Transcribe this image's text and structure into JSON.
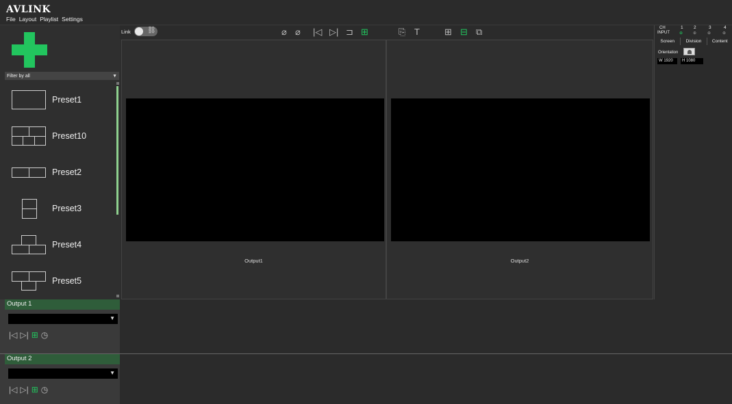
{
  "app": {
    "logo": "AVLINK"
  },
  "menu": [
    {
      "label": "File"
    },
    {
      "label": "Layout"
    },
    {
      "label": "Playlist"
    },
    {
      "label": "Settings"
    }
  ],
  "left_panel": {
    "filter_label": "Filter by all",
    "presets": [
      {
        "label": "Preset1",
        "thumb": "single"
      },
      {
        "label": "Preset10",
        "thumb": "two-top-three-bottom"
      },
      {
        "label": "Preset2",
        "thumb": "two-horizontal"
      },
      {
        "label": "Preset3",
        "thumb": "two-vertical"
      },
      {
        "label": "Preset4",
        "thumb": "one-top-two-bottom"
      },
      {
        "label": "Preset5",
        "thumb": "two-top-one-bottom"
      }
    ]
  },
  "toolbar": {
    "link_label": "Link",
    "link_enabled": false,
    "icons": [
      {
        "name": "hide-icon",
        "glyph": "⌀"
      },
      {
        "name": "hide-all-icon",
        "glyph": "⌀̸"
      },
      {
        "name": "skip-previous-icon",
        "glyph": "|◁"
      },
      {
        "name": "skip-next-icon",
        "glyph": "▷|"
      },
      {
        "name": "input-icon",
        "glyph": "⊐"
      },
      {
        "name": "grid-icon",
        "glyph": "⊞",
        "accent": true
      },
      {
        "name": "export-icon",
        "glyph": "⎘"
      },
      {
        "name": "text-icon",
        "glyph": "T"
      },
      {
        "name": "layout-grid-icon",
        "glyph": "⊞"
      },
      {
        "name": "layout-split-icon",
        "glyph": "⊟",
        "accent": true
      },
      {
        "name": "copy-icon",
        "glyph": "⧉"
      }
    ]
  },
  "canvas": {
    "outputs": [
      {
        "label": "Output1"
      },
      {
        "label": "Output2"
      }
    ]
  },
  "right_panel": {
    "ch_label": "CH",
    "input_label": "INPUT",
    "channels": [
      {
        "number": "1",
        "active": true
      },
      {
        "number": "2",
        "active": false
      },
      {
        "number": "3",
        "active": false
      },
      {
        "number": "4",
        "active": false
      }
    ],
    "tabs": [
      {
        "label": "Screen"
      },
      {
        "label": "Division"
      },
      {
        "label": "Content"
      }
    ],
    "orientation_label": "Orientation",
    "width_label": "W 1920",
    "height_label": "H 1080"
  },
  "output_rows": [
    {
      "title": "Output 1"
    },
    {
      "title": "Output 2"
    }
  ],
  "colors": {
    "accent": "#22c55e",
    "output_header": "#2f5d3a",
    "background": "#2b2b2b"
  }
}
